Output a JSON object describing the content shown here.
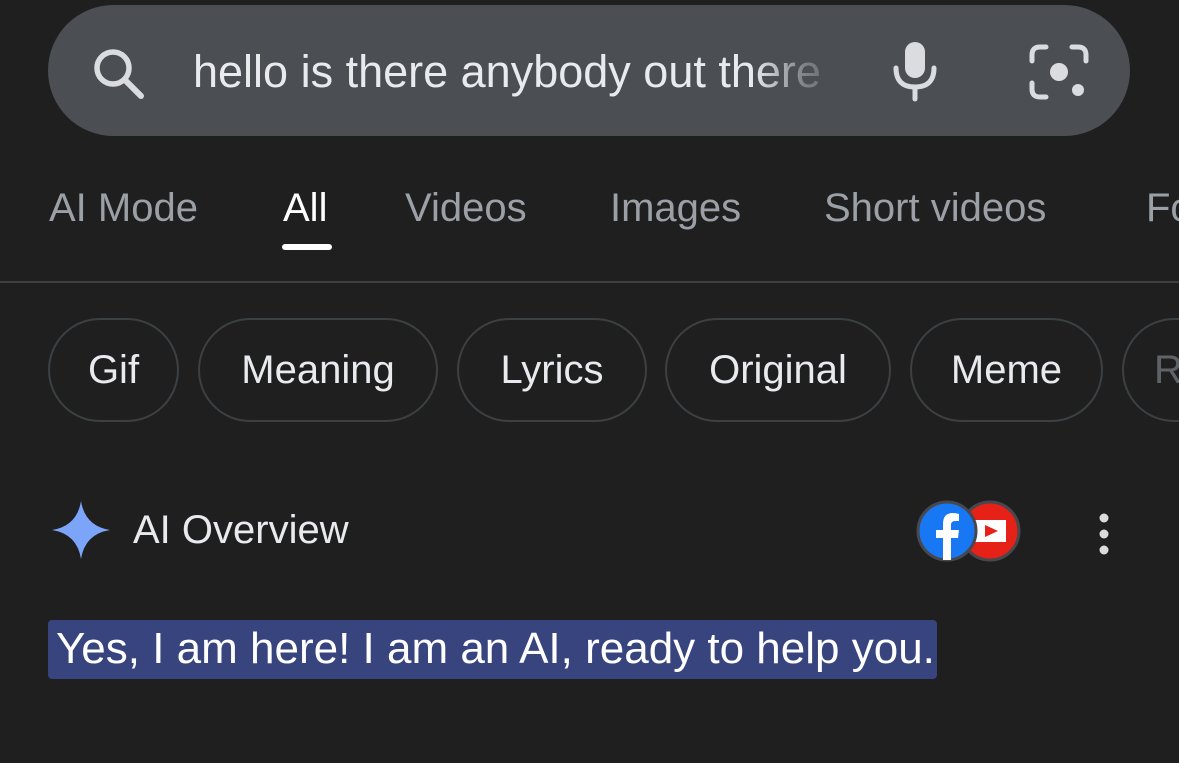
{
  "search": {
    "query": "hello is there anybody out there"
  },
  "tabs": [
    {
      "label": "AI Mode",
      "active": false
    },
    {
      "label": "All",
      "active": true
    },
    {
      "label": "Videos",
      "active": false
    },
    {
      "label": "Images",
      "active": false
    },
    {
      "label": "Short videos",
      "active": false
    },
    {
      "label": "Fo",
      "active": false
    }
  ],
  "chips": [
    {
      "label": "Gif"
    },
    {
      "label": "Meaning"
    },
    {
      "label": "Lyrics"
    },
    {
      "label": "Original"
    },
    {
      "label": "Meme"
    },
    {
      "label": "R"
    }
  ],
  "ai_overview": {
    "title": "AI Overview",
    "source_icons": [
      "facebook-icon",
      "youtube-icon"
    ],
    "answer": "Yes, I am here! I am an AI, ready to help you."
  },
  "colors": {
    "background": "#1f1f1f",
    "search_bar": "#4b4f54",
    "highlight": "#37447e",
    "sparkle": "#7ca4f8",
    "facebook": "#1877f2",
    "youtube": "#e62117"
  }
}
